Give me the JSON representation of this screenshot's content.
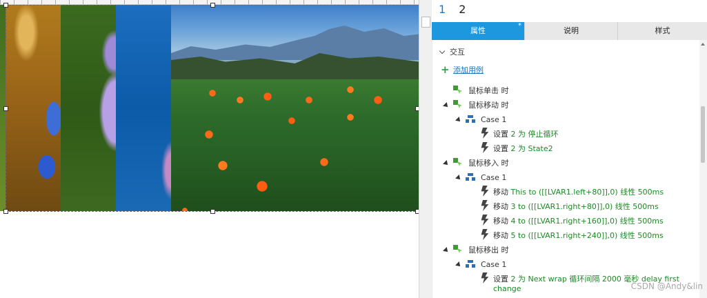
{
  "pages": [
    "1",
    "2"
  ],
  "tabs": {
    "properties": "属性",
    "properties_marker": "*",
    "notes": "说明",
    "style": "样式"
  },
  "section": {
    "interactions": "交互"
  },
  "add_case": "添加用例",
  "events": [
    {
      "label": "鼠标单击 时"
    },
    {
      "label": "鼠标移动 时",
      "case": "Case 1",
      "actions": [
        {
          "verb": "设置",
          "detail": "2 为 停止循环"
        },
        {
          "verb": "设置",
          "detail": "2 为 State2"
        }
      ]
    },
    {
      "label": "鼠标移入 时",
      "case": "Case 1",
      "actions": [
        {
          "verb": "移动",
          "detail": "This to ([[LVAR1.left+80]],0) 线性 500ms"
        },
        {
          "verb": "移动",
          "detail": "3 to ([[LVAR1.right+80]],0) 线性 500ms"
        },
        {
          "verb": "移动",
          "detail": "4 to ([[LVAR1.right+160]],0) 线性 500ms"
        },
        {
          "verb": "移动",
          "detail": "5 to ([[LVAR1.right+240]],0) 线性 500ms"
        }
      ]
    },
    {
      "label": "鼠标移出 时",
      "case": "Case 1",
      "actions": [
        {
          "verb": "设置",
          "detail": "2 为 Next wrap 循环间隔 2000 毫秒 delay first",
          "detail_cont": "change"
        }
      ]
    }
  ],
  "watermark": "CSDN @Andy&lin",
  "colors": {
    "accent": "#1d97dd",
    "action_text": "#1b8a22",
    "link": "#1a73c2"
  },
  "icons": {
    "event": "interaction-event-icon",
    "case": "case-tree-icon",
    "action": "lightning-bolt-icon",
    "add": "plus-icon",
    "collapse": "chevron-down-icon",
    "expand": "triangle-expanded-icon"
  }
}
